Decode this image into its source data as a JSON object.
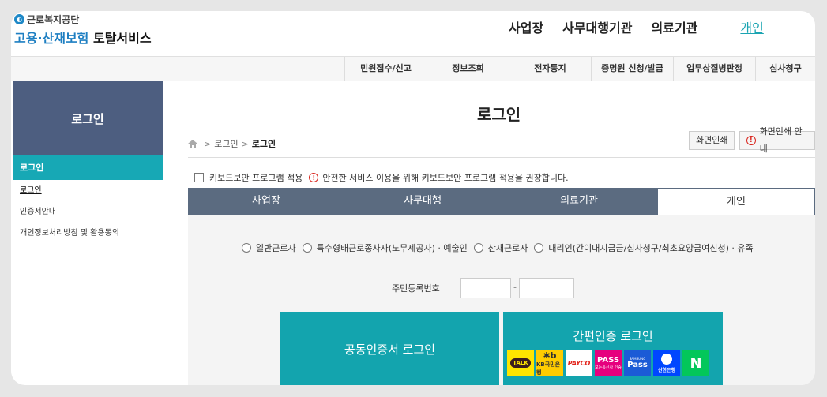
{
  "header": {
    "org_name": "근로복지공단",
    "service_name_blue": "고용·산재보험",
    "service_name_rest": "토탈서비스",
    "nav": [
      "사업장",
      "사무대행기관",
      "의료기관"
    ],
    "nav_active": "개인"
  },
  "sub_nav": [
    "민원접수/신고",
    "정보조회",
    "전자통지",
    "증명원 신청/발급",
    "업무상질병판정",
    "심사청구"
  ],
  "sidebar": {
    "title": "로그인",
    "active": "로그인",
    "items": [
      "로그인",
      "인증서안내",
      "개인정보처리방침 및 활용동의"
    ]
  },
  "main": {
    "title": "로그인",
    "breadcrumb": [
      "로그인",
      "로그인"
    ],
    "print_button": "화면인쇄",
    "print_guide_button": "화면인쇄 안내",
    "keyboard_security_label": "키보드보안 프로그램 적용",
    "keyboard_security_notice": "안전한 서비스 이용을 위해 키보드보안 프로그램 적용을 권장합니다.",
    "tabs": [
      "사업장",
      "사무대행",
      "의료기관",
      "개인"
    ],
    "active_tab": "개인",
    "user_types": [
      "일반근로자",
      "특수형태근로종사자(노무제공자) · 예술인",
      "산재근로자",
      "대리인(간이대지급금/심사청구/최초요양급여신청) · 유족"
    ],
    "rrn_label": "주민등록번호",
    "rrn_dash": "-",
    "cert_login": "공동인증서 로그인",
    "simple_login": "간편인증 로그인",
    "providers": [
      {
        "name": "kakao",
        "label": "TALK"
      },
      {
        "name": "kb",
        "label": "KB국민은행"
      },
      {
        "name": "payco",
        "label": "PAYCO"
      },
      {
        "name": "pass",
        "label": "PASS",
        "sub": "모든통신사 인증"
      },
      {
        "name": "samsung-pass",
        "label": "Pass",
        "sub": "SAMSUNG"
      },
      {
        "name": "shinhan",
        "label": "신한은행"
      },
      {
        "name": "naver",
        "label": "N"
      }
    ]
  }
}
